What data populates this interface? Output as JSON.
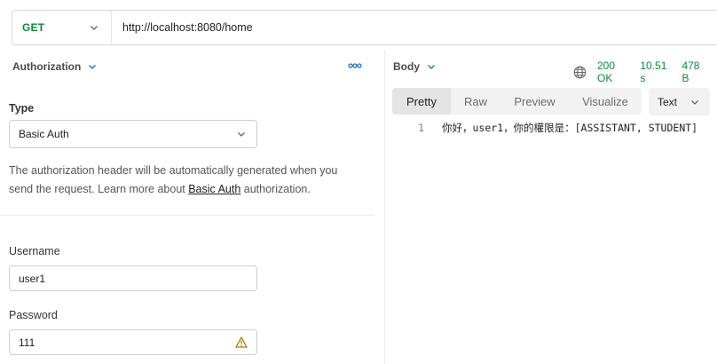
{
  "request": {
    "method": "GET",
    "url": "http://localhost:8080/home"
  },
  "auth": {
    "tab_label": "Authorization",
    "type_label": "Type",
    "type_value": "Basic Auth",
    "description_prefix": "The authorization header will be automatically generated when you send the request. Learn more about ",
    "description_link": "Basic Auth",
    "description_suffix": " authorization.",
    "username_label": "Username",
    "username_value": "user1",
    "password_label": "Password",
    "password_value": "111"
  },
  "response": {
    "body_tab": "Body",
    "status": "200 OK",
    "time": "10.51 s",
    "size": "478 B",
    "view_tabs": [
      "Pretty",
      "Raw",
      "Preview",
      "Visualize"
    ],
    "active_view": "Pretty",
    "format": "Text",
    "lines": [
      {
        "number": "1",
        "text": "你好，user1，你的權限是：[ASSISTANT, STUDENT]"
      }
    ]
  },
  "colors": {
    "method_green": "#0b8a3b",
    "status_green": "#0b8a3b",
    "link_blue": "#1f6bb8",
    "warning_amber": "#b07c00"
  },
  "icons": {
    "method_dropdown": "chevron-down-icon",
    "more": "more-horizontal-icon",
    "globe": "globe-icon",
    "warning": "warning-icon"
  }
}
